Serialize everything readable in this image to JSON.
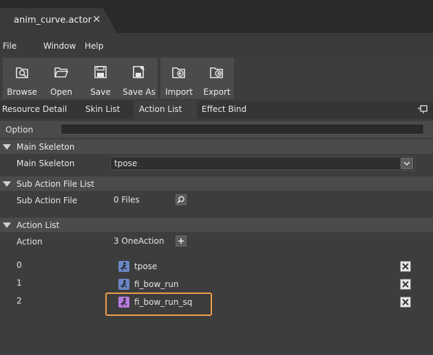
{
  "window": {
    "tab_title": "anim_curve.actor"
  },
  "menu": [
    "File",
    "Window",
    "Help"
  ],
  "toolbar": {
    "browse": "Browse",
    "open": "Open",
    "save": "Save",
    "save_as": "Save As",
    "import": "Import",
    "export": "Export"
  },
  "panel_tabs": [
    "Resource Detail",
    "Skin List",
    "Action List",
    "Effect Bind"
  ],
  "active_tab": "Action List",
  "option": {
    "label": "Option",
    "value": ""
  },
  "main_skeleton": {
    "header": "Main Skeleton",
    "field_label": "Main Skeleton",
    "selected": "tpose"
  },
  "sub_action": {
    "header": "Sub Action File List",
    "field_label": "Sub Action File",
    "value": "0 Files"
  },
  "action_list": {
    "header": "Action List",
    "field_label": "Action",
    "value": "3 OneAction",
    "items": [
      {
        "index": "0",
        "name": "tpose",
        "icon_color": "#6b86c6"
      },
      {
        "index": "1",
        "name": "fi_bow_run",
        "icon_color": "#6b86c6"
      },
      {
        "index": "2",
        "name": "fi_bow_run_sq",
        "icon_color": "#b77be0",
        "highlighted": true
      }
    ]
  },
  "colors": {
    "highlight": "#f0a04b",
    "background": "#3d3d3d"
  }
}
